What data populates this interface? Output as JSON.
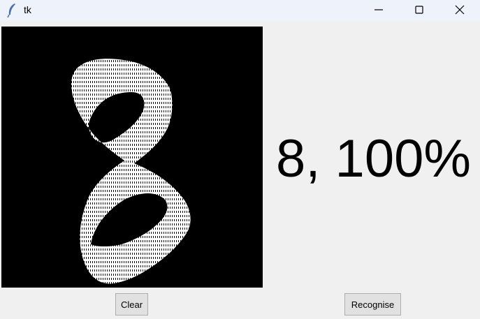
{
  "window": {
    "title": "tk",
    "icon": "feather-icon",
    "controls": [
      "minimize-icon",
      "maximize-icon",
      "close-icon"
    ]
  },
  "prediction": {
    "text": "8, 100%"
  },
  "buttons": {
    "clear_label": "Clear",
    "recognise_label": "Recognise"
  },
  "colors": {
    "canvas_bg": "#000000",
    "stroke": "#ffffff",
    "window_bg": "#f0f0f0",
    "titlebar_bg": "#eef2fa"
  }
}
